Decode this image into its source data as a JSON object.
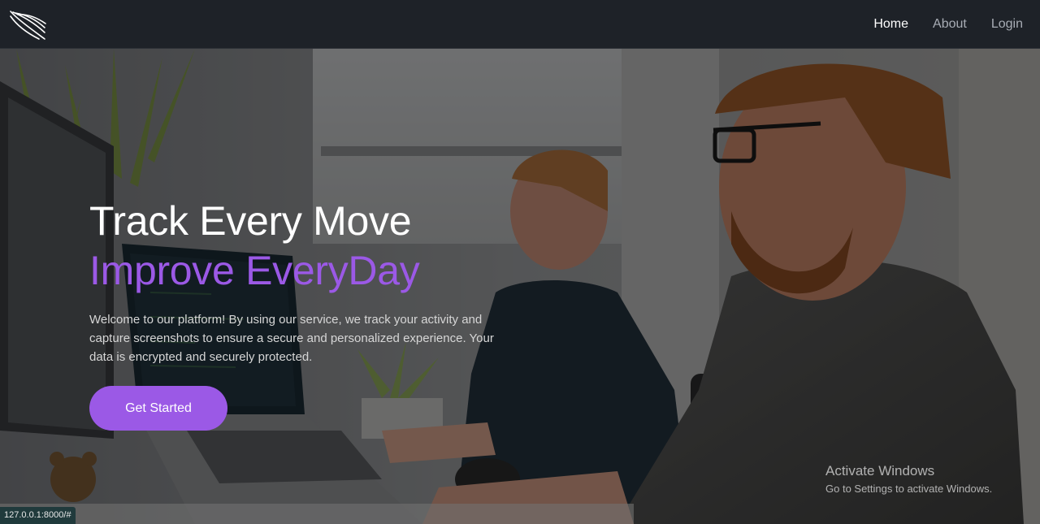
{
  "nav": {
    "logo_icon": "wing-feather-icon",
    "links": [
      {
        "label": "Home",
        "active": true
      },
      {
        "label": "About",
        "active": false
      },
      {
        "label": "Login",
        "active": false
      }
    ]
  },
  "hero": {
    "title": "Track Every Move",
    "subtitle": "Improve EveryDay",
    "text": "Welcome to our platform! By using our service, we track your activity and capture screenshots to ensure a secure and personalized experience. Your data is encrypted and securely protected.",
    "cta_label": "Get Started",
    "accent_color": "#9b59e6"
  },
  "watermark": {
    "title": "Activate Windows",
    "subtitle": "Go to Settings to activate Windows."
  },
  "status_bar": {
    "url": "127.0.0.1:8000/#"
  }
}
